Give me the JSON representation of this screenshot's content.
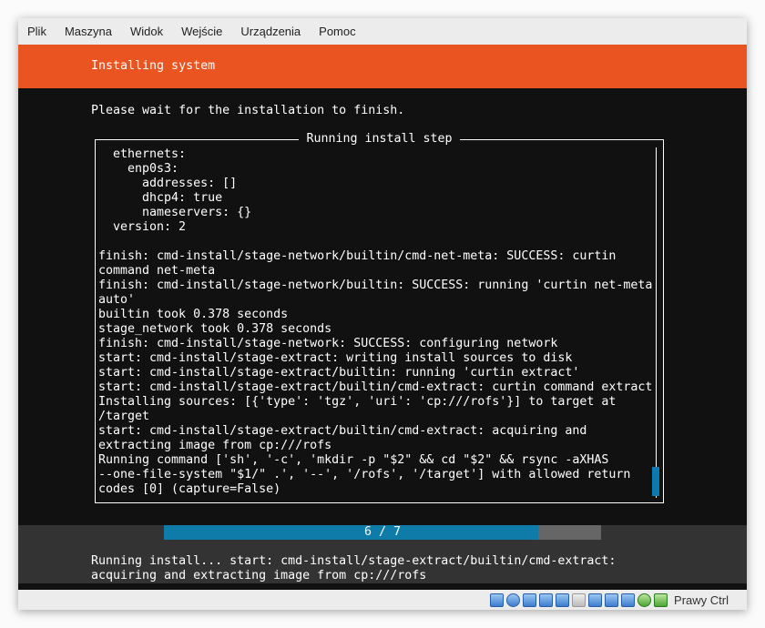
{
  "menu": [
    "Plik",
    "Maszyna",
    "Widok",
    "Wejście",
    "Urządzenia",
    "Pomoc"
  ],
  "header": {
    "title": "Installing system"
  },
  "wait_text": "Please wait for the installation to finish.",
  "log_box": {
    "title": "Running install step",
    "lines": [
      "  ethernets:",
      "    enp0s3:",
      "      addresses: []",
      "      dhcp4: true",
      "      nameservers: {}",
      "  version: 2",
      "",
      "finish: cmd-install/stage-network/builtin/cmd-net-meta: SUCCESS: curtin",
      "command net-meta",
      "finish: cmd-install/stage-network/builtin: SUCCESS: running 'curtin net-meta",
      "auto'",
      "builtin took 0.378 seconds",
      "stage_network took 0.378 seconds",
      "finish: cmd-install/stage-network: SUCCESS: configuring network",
      "start: cmd-install/stage-extract: writing install sources to disk",
      "start: cmd-install/stage-extract/builtin: running 'curtin extract'",
      "start: cmd-install/stage-extract/builtin/cmd-extract: curtin command extract",
      "Installing sources: [{'type': 'tgz', 'uri': 'cp:///rofs'}] to target at",
      "/target",
      "start: cmd-install/stage-extract/builtin/cmd-extract: acquiring and",
      "extracting image from cp:///rofs",
      "Running command ['sh', '-c', 'mkdir -p \"$2\" && cd \"$2\" && rsync -aXHAS",
      "--one-file-system \"$1/\" .', '--', '/rofs', '/target'] with allowed return",
      "codes [0] (capture=False)"
    ],
    "scroll_position": 1.0
  },
  "progress": {
    "label": "6 / 7",
    "current": 6,
    "total": 7
  },
  "status_text": "Running install... start: cmd-install/stage-extract/builtin/cmd-extract:\nacquiring and extracting image from cp:///rofs",
  "statusbar": {
    "icons": [
      "hard-disk-icon",
      "optical-drive-icon",
      "audio-icon",
      "network-icon",
      "usb-icon",
      "shared-folders-icon",
      "display-icon",
      "video-capture-icon",
      "cpu-virtualization-icon",
      "mouse-integration-icon",
      "keyboard-capture-icon"
    ],
    "host_key": "Prawy Ctrl"
  },
  "colors": {
    "accent": "#e95420",
    "progress": "#0e7ba8"
  }
}
